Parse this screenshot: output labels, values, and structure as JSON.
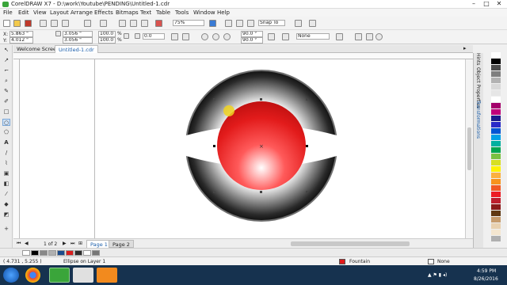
{
  "titlebar": {
    "title": "CorelDRAW X7 - D:\\work\\Youtube\\PENDING\\Untitled-1.cdr",
    "minimize": "–",
    "maximize": "□",
    "close": "✕"
  },
  "menu": [
    "File",
    "Edit",
    "View",
    "Layout",
    "Arrange",
    "Effects",
    "Bitmaps",
    "Text",
    "Table",
    "Tools",
    "Window",
    "Help"
  ],
  "toolbar": {
    "zoom": "75%",
    "snap_to": "Snap To"
  },
  "propbar": {
    "x_label": "X:",
    "x": "5.863 \"",
    "y_label": "Y:",
    "y": "4.012 \"",
    "w": "3.056 \"",
    "h": "3.056 \"",
    "scale_w": "100.0",
    "scale_h": "100.0",
    "pct": "%",
    "rotation": "0.0",
    "angle1": "90.0 °",
    "angle2": "90.0 °",
    "outline": "None"
  },
  "tabs": {
    "welcome": "Welcome Screen",
    "doc": "Untitled-1.cdr"
  },
  "docker": {
    "hints": "Hints",
    "object_props": "Object Properties",
    "transformations": "Transformations"
  },
  "pagenav": {
    "counter": "1 of 2",
    "page1": "Page 1",
    "page2": "Page 2"
  },
  "status": {
    "coords": "( 4.731 , 5.255 )",
    "object": "Ellipse on Layer 1",
    "fill": "Fountain",
    "outline": "None"
  },
  "clock": {
    "time": "4:59 PM",
    "date": "8/26/2016"
  },
  "colors": {
    "accent": "#1b5eaa",
    "taskbar": "#16324f",
    "sphere": "#e21b1b"
  },
  "palette": [
    "#ffffff",
    "#000000",
    "#4b4b4b",
    "#7f7f7f",
    "#b2b2b2",
    "#d8d8d8",
    "#e6e6e6",
    "#ffffff",
    "#a3006b",
    "#c0007a",
    "#1a1a8c",
    "#2b2bc8",
    "#0055d4",
    "#00a0e6",
    "#00b0a0",
    "#00a550",
    "#7ac142",
    "#d7df23",
    "#fff200",
    "#fbb040",
    "#f7941d",
    "#f15a24",
    "#ed1c24",
    "#be1e2d",
    "#8b1a1a",
    "#603913",
    "#c69c6d",
    "#e8d1b0",
    "#f4e6d0",
    "#b0b0b0"
  ],
  "docpalette": [
    "#ffffff",
    "#000000",
    "#888888",
    "#b0b0b0",
    "#1b4c8c",
    "#d81e1e",
    "#2d2d2d",
    "#ffffff",
    "#777777"
  ]
}
